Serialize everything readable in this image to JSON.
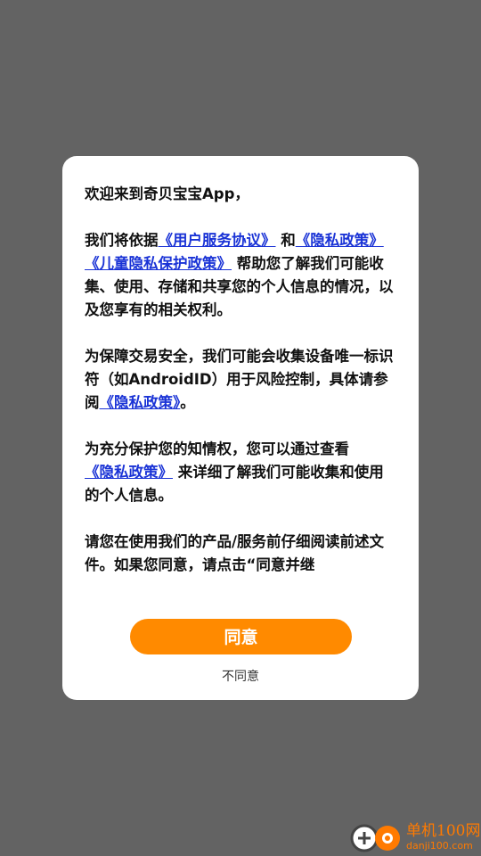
{
  "dialog": {
    "greeting": "欢迎来到奇贝宝宝App，",
    "p1_pre": "我们将依据",
    "link_user_agreement": "《用户服务协议》",
    "p1_and": " 和",
    "link_privacy_policy": "《隐私政策》",
    "p1_space": " ",
    "link_child_privacy": "《儿童隐私保护政策》",
    "p1_post": " 帮助您了解我们可能收集、使用、存储和共享您的个人信息的情况，以及您享有的相关权利。",
    "p2_pre": "为保障交易安全，我们可能会收集设备唯一标识符（如AndroidID）用于风险控制，具体请参阅",
    "p2_link": "《隐私政策》",
    "p2_post": "。",
    "p3_pre": "为充分保护您的知情权，您可以通过查看",
    "p3_link": "《隐私政策》",
    "p3_post": " 来详细了解我们可能收集和使用的个人信息。",
    "p4": "请您在使用我们的产品/服务前仔细阅读前述文件。如果您同意，请点击“同意并继",
    "agree_label": "同意",
    "disagree_label": "不同意"
  },
  "watermark": {
    "name": "单机100网",
    "domain": "danji100.com"
  },
  "colors": {
    "overlay": "#636363",
    "accent": "#ff8a00",
    "link": "#1a33d6"
  }
}
